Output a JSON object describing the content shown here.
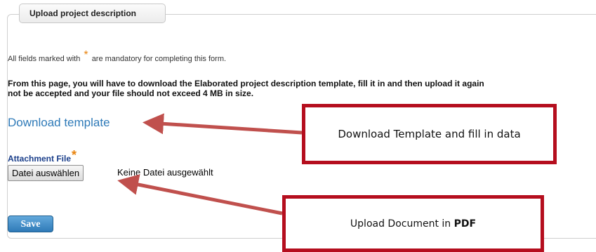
{
  "fieldset": {
    "legend": "Upload project description"
  },
  "form": {
    "mandatory_prefix": "All fields marked with",
    "mandatory_star": "*",
    "mandatory_suffix": "are mandatory for completing this form.",
    "instructions_line1": "From this page, you will have to download the Elaborated project description template, fill it in and then upload it again",
    "instructions_line2": "not be accepted and your file should not exceed 4 MB in size.",
    "download_link": "Download template",
    "attachment_label": "Attachment File",
    "attachment_star": "*",
    "file_button": "Datei auswählen",
    "file_status": "Keine Datei ausgewählt",
    "save_button": "Save"
  },
  "annotations": {
    "callout_download": "Download Template and fill in data",
    "callout_upload_prefix": "Upload Document in",
    "callout_upload_bold": "PDF"
  },
  "colors": {
    "accent_link": "#2e7ab8",
    "label_blue": "#1a3e8a",
    "required_star": "#e8820c",
    "annotation_red": "#b50e1e",
    "arrow_red": "#c0504d"
  }
}
